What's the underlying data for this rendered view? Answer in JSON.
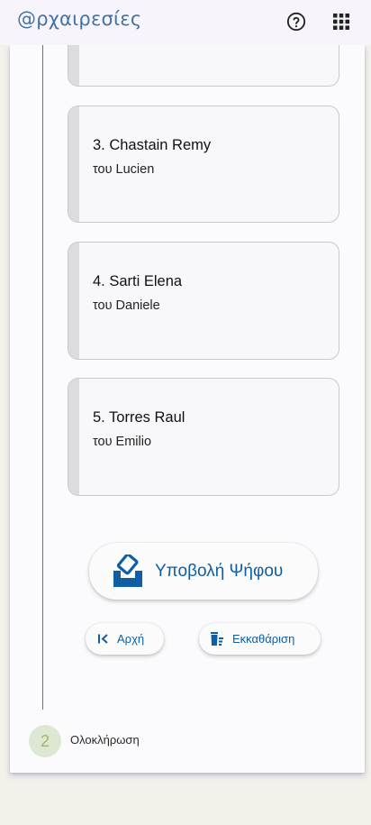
{
  "header": {
    "brand": "@ρχαιρεσίες",
    "help_icon": "help-circle-icon",
    "apps_icon": "apps-grid-icon"
  },
  "candidates": [
    {
      "name": "",
      "subtitle": ""
    },
    {
      "name": "3. Chastain Remy",
      "subtitle": "του Lucien"
    },
    {
      "name": "4. Sarti Elena",
      "subtitle": "του Daniele"
    },
    {
      "name": "5. Torres Raul",
      "subtitle": "του Emilio"
    }
  ],
  "actions": {
    "submit_label": "Υποβολή Ψήφου",
    "start_label": "Αρχή",
    "clear_label": "Εκκαθάριση"
  },
  "stepper": {
    "step_number": "2",
    "step_label": "Ολοκλήρωση"
  },
  "colors": {
    "accent": "#0f5ea3",
    "brand": "#4272a6",
    "step_circle": "#dde7d2"
  }
}
